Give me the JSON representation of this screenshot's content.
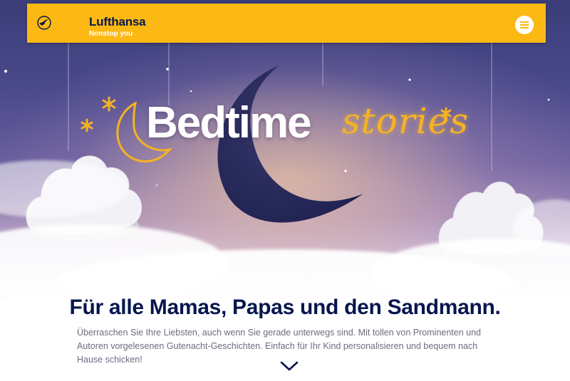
{
  "header": {
    "brand": "Lufthansa",
    "tagline": "Nonstop you",
    "logo_icon": "crane-logo-icon",
    "menu_icon": "hamburger-menu-icon"
  },
  "hero": {
    "title_main": "Bedtime",
    "title_script": "stories"
  },
  "content": {
    "headline": "Für alle Mamas, Papas und den Sandmann.",
    "intro": "Überraschen Sie Ihre Liebsten, auch wenn Sie gerade unterwegs sind. Mit tollen von Prominenten und Autoren vorgelesenen Gutenacht-Geschichten. Einfach für Ihr Kind personalisieren und bequem nach Hause schicken!"
  },
  "colors": {
    "brand_yellow": "#fdb913",
    "navy": "#05164d",
    "sky_top": "#3a3d78",
    "script_gold": "#f6b222"
  }
}
